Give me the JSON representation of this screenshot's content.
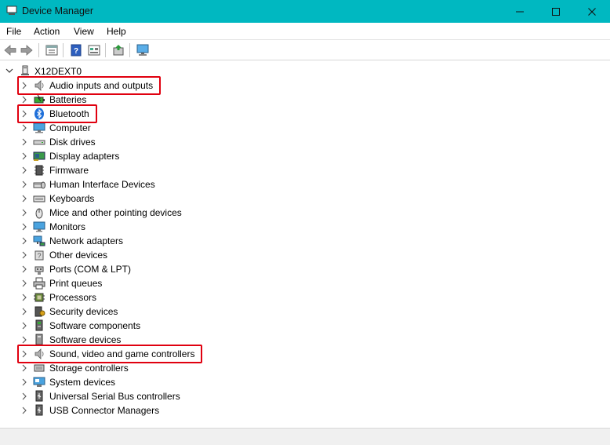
{
  "window": {
    "title": "Device Manager",
    "controls": {
      "minimize_icon": "minimize-icon",
      "maximize_icon": "maximize-icon",
      "close_icon": "close-icon"
    }
  },
  "menu": {
    "file": "File",
    "action": "Action",
    "view": "View",
    "help": "Help"
  },
  "toolbar": [
    "back-icon",
    "forward-icon",
    "properties-icon",
    "help-icon",
    "view-icon",
    "update-driver-icon",
    "scan-hardware-icon"
  ],
  "tree": {
    "root": {
      "label": "X12DEXT0",
      "icon": "computer-icon"
    },
    "categories": [
      {
        "label": "Audio inputs and outputs",
        "icon": "speaker-icon"
      },
      {
        "label": "Batteries",
        "icon": "battery-icon"
      },
      {
        "label": "Bluetooth",
        "icon": "bluetooth-icon"
      },
      {
        "label": "Computer",
        "icon": "computer-icon"
      },
      {
        "label": "Disk drives",
        "icon": "disk-drive-icon"
      },
      {
        "label": "Display adapters",
        "icon": "display-adapter-icon"
      },
      {
        "label": "Firmware",
        "icon": "firmware-icon"
      },
      {
        "label": "Human Interface Devices",
        "icon": "hid-icon"
      },
      {
        "label": "Keyboards",
        "icon": "keyboard-icon"
      },
      {
        "label": "Mice and other pointing devices",
        "icon": "mouse-icon"
      },
      {
        "label": "Monitors",
        "icon": "monitor-icon"
      },
      {
        "label": "Network adapters",
        "icon": "network-icon"
      },
      {
        "label": "Other devices",
        "icon": "unknown-device-icon"
      },
      {
        "label": "Ports (COM & LPT)",
        "icon": "port-icon"
      },
      {
        "label": "Print queues",
        "icon": "printer-icon"
      },
      {
        "label": "Processors",
        "icon": "processor-icon"
      },
      {
        "label": "Security devices",
        "icon": "security-icon"
      },
      {
        "label": "Software components",
        "icon": "software-component-icon"
      },
      {
        "label": "Software devices",
        "icon": "software-device-icon"
      },
      {
        "label": "Sound, video and game controllers",
        "icon": "speaker-icon"
      },
      {
        "label": "Storage controllers",
        "icon": "storage-icon"
      },
      {
        "label": "System devices",
        "icon": "system-icon"
      },
      {
        "label": "Universal Serial Bus controllers",
        "icon": "usb-icon"
      },
      {
        "label": "USB Connector Managers",
        "icon": "usb-icon"
      }
    ],
    "highlighted": [
      "Audio inputs and outputs",
      "Bluetooth",
      "Sound, video and game controllers"
    ]
  },
  "colors": {
    "titlebar": "#00b8c1",
    "highlight_box": "#e0000f"
  }
}
